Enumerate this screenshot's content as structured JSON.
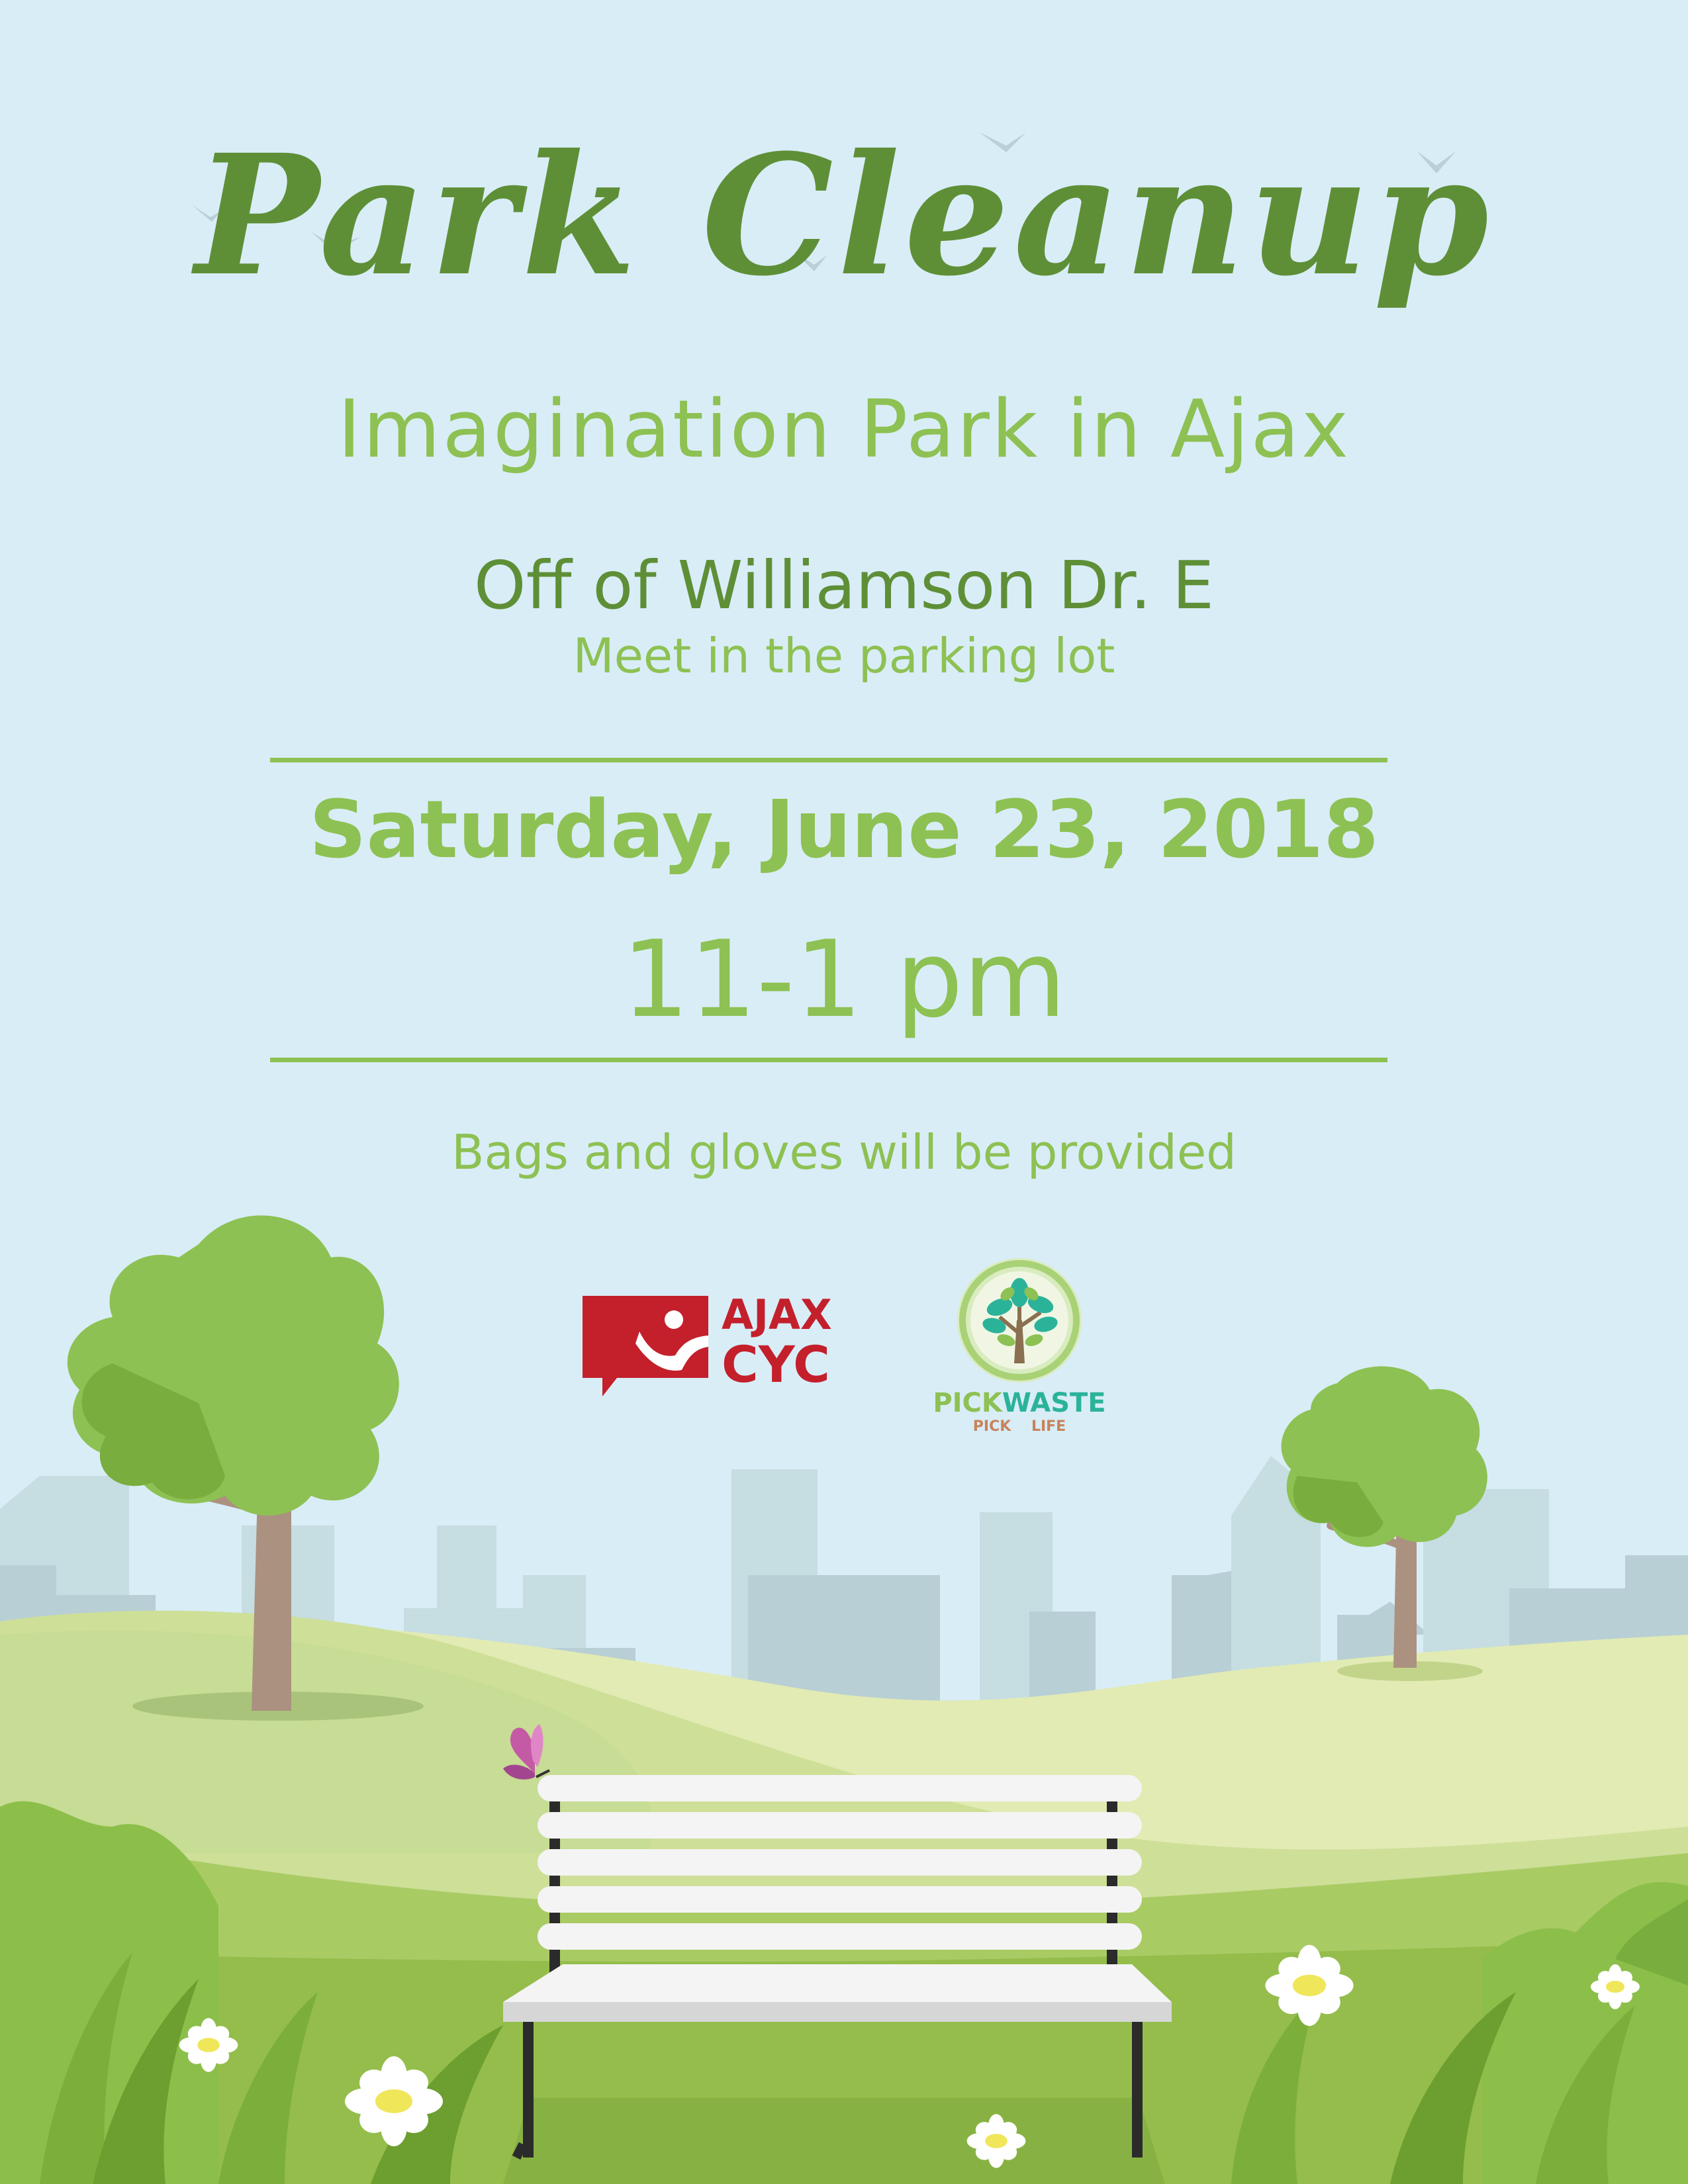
{
  "flyer": {
    "title": "Park Cleanup",
    "subtitle": "Imagination Park in Ajax",
    "street": "Off of Williamson Dr. E",
    "meeting_point": "Meet in the parking lot",
    "date": "Saturday, June 23, 2018",
    "time": "11-1 pm",
    "note": "Bags and gloves will be provided"
  },
  "logos": {
    "ajax": {
      "line1": "AJAX",
      "line2": "CYC"
    },
    "pickwaste": {
      "pick": "PICK",
      "waste": "WASTE",
      "tagline_left": "PICK",
      "tagline_right": "LIFE"
    }
  },
  "colors": {
    "sky": "#d9edf7",
    "title_green": "#5e8f37",
    "accent_green": "#8dc153",
    "ajax_red": "#c3202c",
    "pickwaste_teal": "#2bb39a"
  },
  "illustration": {
    "icons": [
      "bird-icon",
      "tree-icon",
      "bench-icon",
      "butterfly-icon",
      "daisy-icon",
      "city-skyline"
    ]
  }
}
